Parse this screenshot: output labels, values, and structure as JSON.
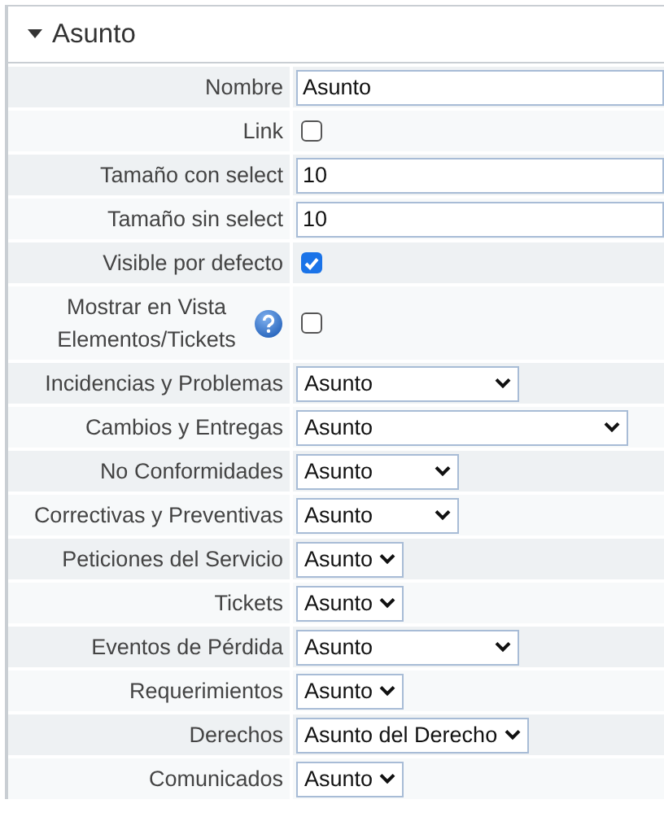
{
  "panel": {
    "title": "Asunto",
    "expanded": true
  },
  "fields": [
    {
      "kind": "text",
      "label": "Nombre",
      "value": "Asunto"
    },
    {
      "kind": "checkbox",
      "label": "Link",
      "checked": false
    },
    {
      "kind": "text",
      "label": "Tamaño con select",
      "value": "10"
    },
    {
      "kind": "text",
      "label": "Tamaño sin select",
      "value": "10"
    },
    {
      "kind": "checkbox",
      "label": "Visible por defecto",
      "checked": true
    },
    {
      "kind": "checkbox",
      "label": "Mostrar en Vista Elementos/Tickets",
      "checked": false,
      "help": true
    },
    {
      "kind": "select",
      "label": "Incidencias y Problemas",
      "value": "Asunto"
    },
    {
      "kind": "select",
      "label": "Cambios y Entregas",
      "value": "Asunto"
    },
    {
      "kind": "select",
      "label": "No Conformidades",
      "value": "Asunto"
    },
    {
      "kind": "select",
      "label": "Correctivas y Preventivas",
      "value": "Asunto"
    },
    {
      "kind": "select",
      "label": "Peticiones del Servicio",
      "value": "Asunto"
    },
    {
      "kind": "select",
      "label": "Tickets",
      "value": "Asunto"
    },
    {
      "kind": "select",
      "label": "Eventos de Pérdida",
      "value": "Asunto"
    },
    {
      "kind": "select",
      "label": "Requerimientos",
      "value": "Asunto"
    },
    {
      "kind": "select",
      "label": "Derechos",
      "value": "Asunto del Derecho"
    },
    {
      "kind": "select",
      "label": "Comunicados",
      "value": "Asunto"
    }
  ]
}
